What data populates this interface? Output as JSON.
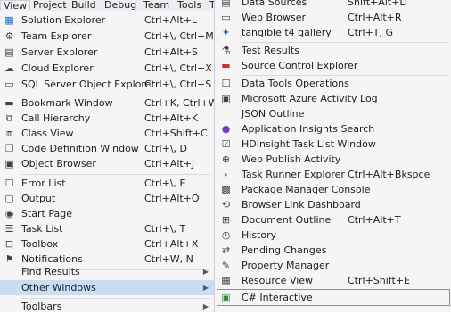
{
  "menubar": {
    "items": [
      "View",
      "Project",
      "Build",
      "Debug",
      "Team",
      "Tools",
      "T"
    ]
  },
  "view_menu": {
    "items": [
      {
        "label": "Solution Explorer",
        "shortcut": "Ctrl+Alt+L",
        "icon": "solution-explorer-icon"
      },
      {
        "label": "Team Explorer",
        "shortcut": "Ctrl+\\, Ctrl+M",
        "icon": "team-explorer-icon"
      },
      {
        "label": "Server Explorer",
        "shortcut": "Ctrl+Alt+S",
        "icon": "server-explorer-icon"
      },
      {
        "label": "Cloud Explorer",
        "shortcut": "Ctrl+\\, Ctrl+X",
        "icon": "cloud-icon"
      },
      {
        "label": "SQL Server Object Explorer",
        "shortcut": "Ctrl+\\, Ctrl+S",
        "icon": "sql-server-icon"
      },
      {
        "label": "Bookmark Window",
        "shortcut": "Ctrl+K, Ctrl+W",
        "icon": "bookmark-icon"
      },
      {
        "label": "Call Hierarchy",
        "shortcut": "Ctrl+Alt+K",
        "icon": "call-hierarchy-icon"
      },
      {
        "label": "Class View",
        "shortcut": "Ctrl+Shift+C",
        "icon": "class-view-icon"
      },
      {
        "label": "Code Definition Window",
        "shortcut": "Ctrl+\\, D",
        "icon": "code-definition-icon"
      },
      {
        "label": "Object Browser",
        "shortcut": "Ctrl+Alt+J",
        "icon": "object-browser-icon"
      },
      {
        "label": "Error List",
        "shortcut": "Ctrl+\\, E",
        "icon": "error-list-icon"
      },
      {
        "label": "Output",
        "shortcut": "Ctrl+Alt+O",
        "icon": "output-icon"
      },
      {
        "label": "Start Page",
        "shortcut": "",
        "icon": "start-page-icon"
      },
      {
        "label": "Task List",
        "shortcut": "Ctrl+\\, T",
        "icon": "task-list-icon"
      },
      {
        "label": "Toolbox",
        "shortcut": "Ctrl+Alt+X",
        "icon": "toolbox-icon"
      },
      {
        "label": "Notifications",
        "shortcut": "Ctrl+W, N",
        "icon": "notifications-icon"
      },
      {
        "label": "Find Results",
        "shortcut": "",
        "icon": ""
      },
      {
        "label": "Other Windows",
        "shortcut": "",
        "icon": ""
      },
      {
        "label": "Toolbars",
        "shortcut": "",
        "icon": ""
      }
    ]
  },
  "other_windows_menu": {
    "items": [
      {
        "label": "Data Sources",
        "shortcut": "Shift+Alt+D",
        "icon": "data-sources-icon"
      },
      {
        "label": "Web Browser",
        "shortcut": "Ctrl+Alt+R",
        "icon": "web-browser-icon"
      },
      {
        "label": "tangible t4 gallery",
        "shortcut": "Ctrl+T, G",
        "icon": "t4-gallery-icon"
      },
      {
        "label": "Test Results",
        "shortcut": "",
        "icon": "test-results-icon"
      },
      {
        "label": "Source Control Explorer",
        "shortcut": "",
        "icon": "source-control-icon"
      },
      {
        "label": "Data Tools Operations",
        "shortcut": "",
        "icon": "data-tools-icon"
      },
      {
        "label": "Microsoft Azure Activity Log",
        "shortcut": "",
        "icon": "azure-log-icon"
      },
      {
        "label": "JSON Outline",
        "shortcut": "",
        "icon": ""
      },
      {
        "label": "Application Insights Search",
        "shortcut": "",
        "icon": "app-insights-icon"
      },
      {
        "label": "HDInsight Task List Window",
        "shortcut": "",
        "icon": "hdinsight-icon"
      },
      {
        "label": "Web Publish Activity",
        "shortcut": "",
        "icon": "web-publish-icon"
      },
      {
        "label": "Task Runner Explorer",
        "shortcut": "Ctrl+Alt+Bkspce",
        "icon": "task-runner-icon"
      },
      {
        "label": "Package Manager Console",
        "shortcut": "",
        "icon": "package-manager-icon"
      },
      {
        "label": "Browser Link Dashboard",
        "shortcut": "",
        "icon": "browser-link-icon"
      },
      {
        "label": "Document Outline",
        "shortcut": "Ctrl+Alt+T",
        "icon": "document-outline-icon"
      },
      {
        "label": "History",
        "shortcut": "",
        "icon": "history-icon"
      },
      {
        "label": "Pending Changes",
        "shortcut": "",
        "icon": "pending-changes-icon"
      },
      {
        "label": "Property Manager",
        "shortcut": "",
        "icon": "property-manager-icon"
      },
      {
        "label": "Resource View",
        "shortcut": "Ctrl+Shift+E",
        "icon": "resource-view-icon"
      },
      {
        "label": "C# Interactive",
        "shortcut": "",
        "icon": "csharp-interactive-icon"
      }
    ]
  }
}
